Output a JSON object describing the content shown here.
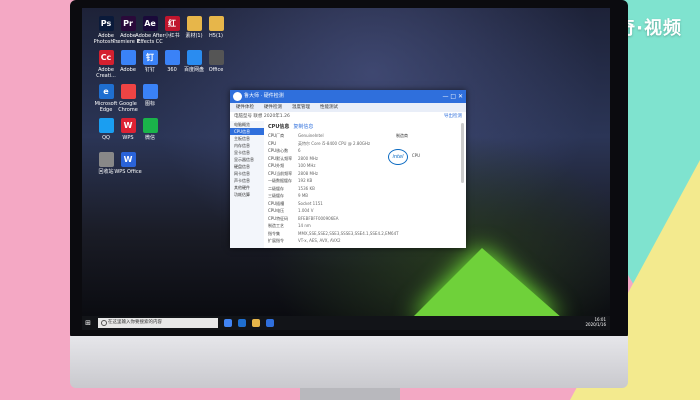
{
  "watermark": "天奇·视频",
  "desktop_icons": [
    {
      "label": "Adobe Photosh...",
      "glyph": "Ps",
      "color": "#0a1a3a"
    },
    {
      "label": "Adobe Premiere P...",
      "glyph": "Pr",
      "color": "#2a0a3a"
    },
    {
      "label": "Adobe After Effects CC",
      "glyph": "Ae",
      "color": "#1a0a3a"
    },
    {
      "label": "小红书",
      "glyph": "红",
      "color": "#c0152d"
    },
    {
      "label": "素材(1)",
      "glyph": "",
      "color": "#e7b64a"
    },
    {
      "label": "H5(1)",
      "glyph": "",
      "color": "#e7b64a"
    },
    {
      "label": "Adobe Creati...",
      "glyph": "Cc",
      "color": "#d4202f"
    },
    {
      "label": "Adobe",
      "glyph": "",
      "color": "#3a82f7"
    },
    {
      "label": "钉钉",
      "glyph": "钉",
      "color": "#3a82f7"
    },
    {
      "label": "360",
      "glyph": "",
      "color": "#3a82f7"
    },
    {
      "label": "百度网盘",
      "glyph": "",
      "color": "#2a8cf0"
    },
    {
      "label": "Office",
      "glyph": "",
      "color": "#555"
    },
    {
      "label": "Microsoft Edge",
      "glyph": "e",
      "color": "#1f6fd0"
    },
    {
      "label": "Google Chrome",
      "glyph": "",
      "color": "#e44"
    },
    {
      "label": "图标",
      "glyph": "",
      "color": "#3a82f7"
    },
    {
      "label": "QQ",
      "glyph": "",
      "color": "#1a9ef1"
    },
    {
      "label": "WPS",
      "glyph": "W",
      "color": "#d23"
    },
    {
      "label": "微信",
      "glyph": "",
      "color": "#1ab34a"
    },
    {
      "label": "回收站",
      "glyph": "",
      "color": "#888"
    },
    {
      "label": "WPS Office",
      "glyph": "W",
      "color": "#2a63d8"
    }
  ],
  "window": {
    "title": "鲁大师 · 硬件检测",
    "tabs": [
      "硬件体检",
      "硬件检测",
      "温度管理",
      "性能测试"
    ],
    "info_text": "电脑型号 联想 2020年1.26",
    "info_link": "导出检测",
    "sidebar": [
      "电脑概览",
      "CPU信息",
      "主板信息",
      "内存信息",
      "显卡信息",
      "显示器信息",
      "硬盘信息",
      "网卡信息",
      "声卡信息",
      "其他硬件",
      "功耗估算"
    ],
    "main_title": "CPU信息",
    "main_link": "复制信息",
    "rows": [
      {
        "k": "CPU厂商",
        "v": "GenuineIntel"
      },
      {
        "k": "CPU",
        "v": "英特尔 Core i5-8400 CPU @ 2.80GHz"
      },
      {
        "k": "CPU核心数",
        "v": "6"
      },
      {
        "k": "CPU默认频率",
        "v": "2800 MHz"
      },
      {
        "k": "CPU外频",
        "v": "100 MHz"
      },
      {
        "k": "CPU当前频率",
        "v": "2808 MHz"
      },
      {
        "k": "一级数据缓存",
        "v": "192 KB"
      },
      {
        "k": "二级缓存",
        "v": "1536 KB"
      },
      {
        "k": "三级缓存",
        "v": "9 MB"
      },
      {
        "k": "CPU插槽",
        "v": "Socket 1151"
      },
      {
        "k": "CPU电压",
        "v": "1.004 V"
      },
      {
        "k": "CPU特征码",
        "v": "BFEBFBFF000906EA"
      },
      {
        "k": "制造工艺",
        "v": "14 nm"
      },
      {
        "k": "指令集",
        "v": "MMX,SSE,SSE2,SSE3,SSSE3,SSE4.1,SSE4.2,EM64T"
      },
      {
        "k": "扩展指令",
        "v": "VT-x, AES, AVX, AVX2"
      }
    ],
    "intel_caption": "制造商",
    "intel_logo": "intel",
    "intel_label": "CPU"
  },
  "taskbar": {
    "start": "⊞",
    "search_placeholder": "在这里输入你要搜索的内容",
    "time": "16:01",
    "date": "2020/1/16"
  }
}
